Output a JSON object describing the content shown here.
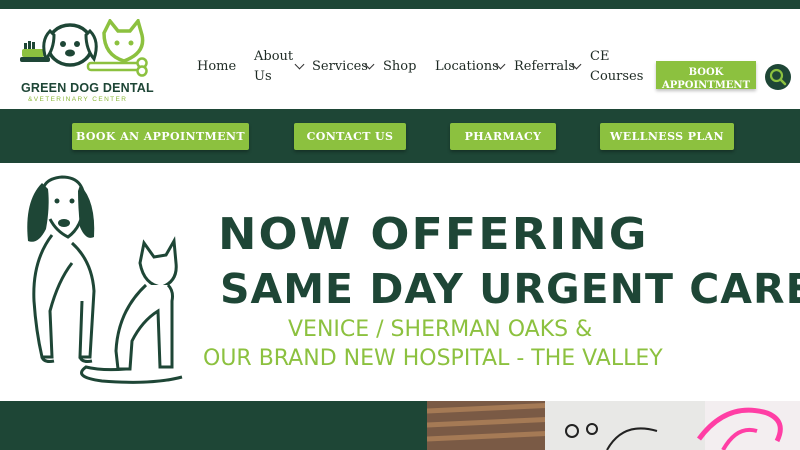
{
  "brand": {
    "name": "GREEN DOG DENTAL",
    "subtitle": "&VETERINARY CENTER",
    "colors": {
      "dark_green": "#1e4636",
      "light_green": "#8cc13f"
    }
  },
  "nav": {
    "home": "Home",
    "about_line1": "About",
    "about_line2": "Us",
    "services": "Services",
    "shop": "Shop",
    "locations": "Locations",
    "referrals": "Referrals",
    "ce_line1": "CE",
    "ce_line2": "Courses"
  },
  "header_cta": {
    "book_line1": "BOOK",
    "book_line2": "APPOINTMENT",
    "search_icon": "search-icon"
  },
  "action_bar": {
    "book": "BOOK AN APPOINTMENT",
    "contact": "CONTACT US",
    "pharmacy": "PHARMACY",
    "wellness": "WELLNESS PLAN"
  },
  "banner": {
    "headline_1": "NOW OFFERING",
    "headline_2": "SAME DAY URGENT CARE",
    "subline_1": "VENICE / SHERMAN OAKS &",
    "subline_2": "OUR BRAND NEW HOSPITAL - THE VALLEY"
  }
}
